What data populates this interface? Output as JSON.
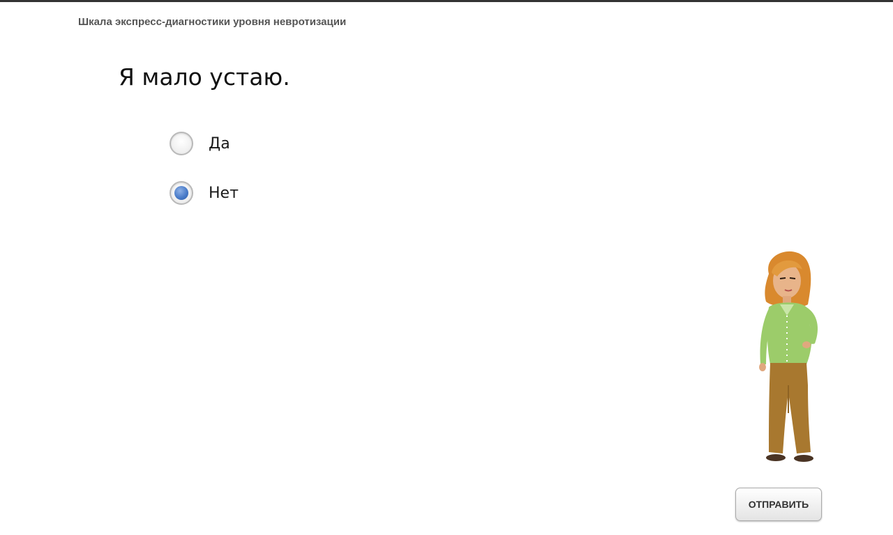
{
  "header": {
    "title": "Шкала экспресс-диагностики уровня невротизации"
  },
  "question": {
    "text": "Я мало устаю.",
    "options": [
      {
        "label": "Да",
        "selected": false
      },
      {
        "label": "Нет",
        "selected": true
      }
    ]
  },
  "character": {
    "icon": "woman-character-illustration"
  },
  "actions": {
    "submit_label": "ОТПРАВИТЬ"
  },
  "colors": {
    "radio_selected": "#4a7cc9",
    "top_border": "#333333",
    "shirt": "#9ccc6a",
    "pants": "#a8782f",
    "hair": "#d9892e"
  }
}
